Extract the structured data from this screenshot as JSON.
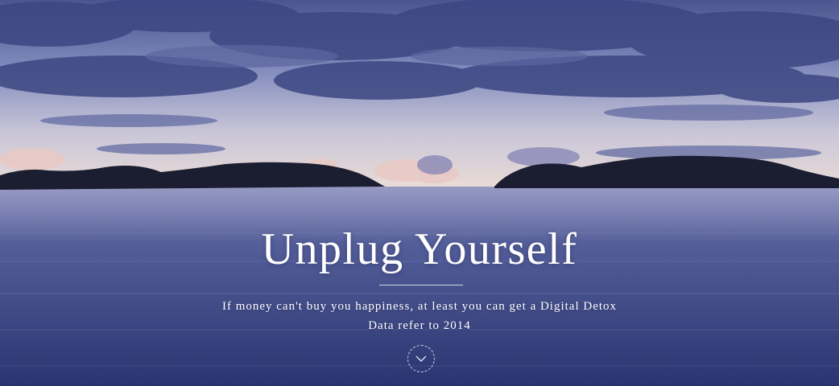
{
  "hero": {
    "title": "Unplug Yourself",
    "subtitle": "If money can't buy you happiness, at least you can get a Digital Detox",
    "note": "Data refer to 2014",
    "scroll_icon": "chevron-down-icon"
  },
  "colors": {
    "sky_top": "#4a5490",
    "sky_horizon": "#e8d8d0",
    "sea_top": "#5a64a0",
    "sea_bottom": "#2c3672",
    "island": "#1a1c30",
    "text": "#ffffff"
  }
}
